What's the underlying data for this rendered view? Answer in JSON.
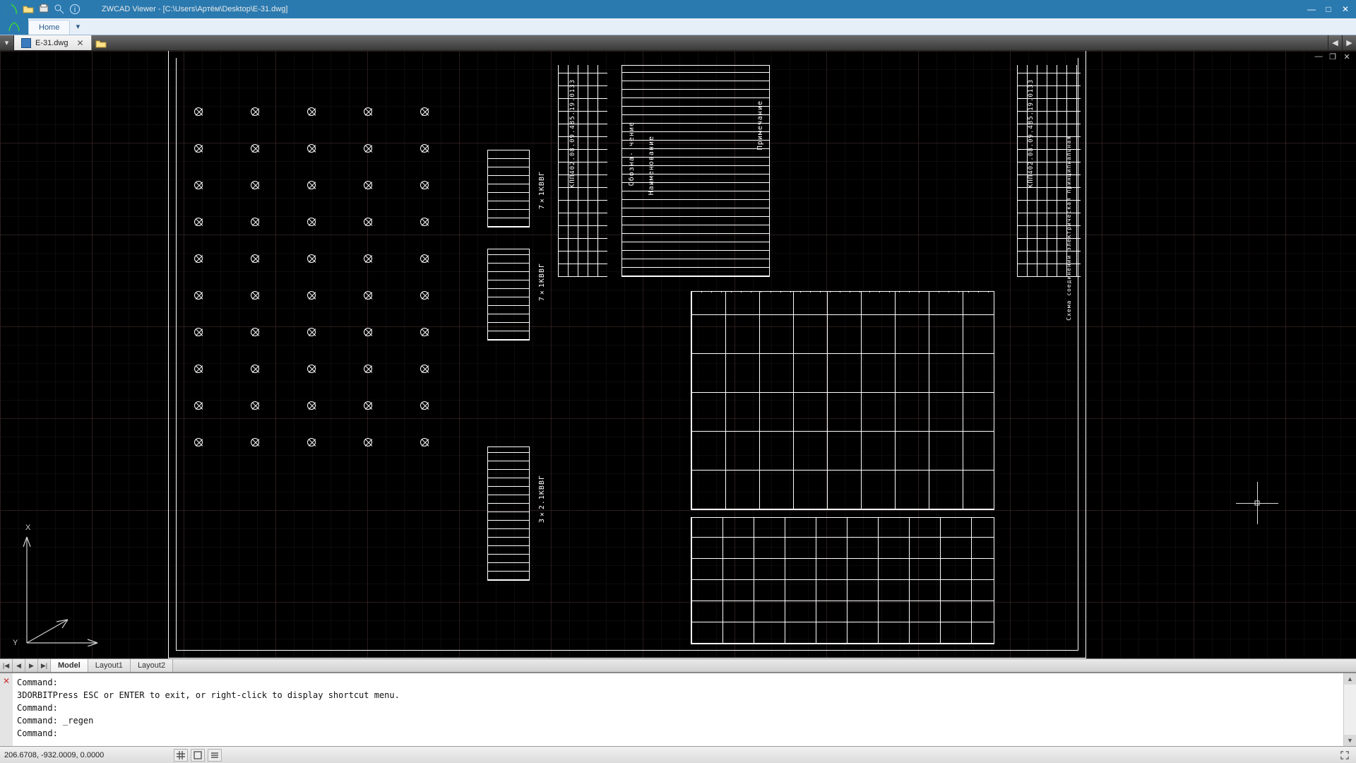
{
  "window": {
    "title": "ZWCAD Viewer - [C:\\Users\\Артём\\Desktop\\E-31.dwg]"
  },
  "ribbon": {
    "home": "Home"
  },
  "file_tab": {
    "name": "E-31.dwg"
  },
  "mdi": {
    "min": "—",
    "max": "❐",
    "close": "✕"
  },
  "layouts": {
    "nav": {
      "first": "|◀",
      "prev": "◀",
      "next": "▶",
      "last": "▶|"
    },
    "tabs": [
      "Model",
      "Layout1",
      "Layout2"
    ]
  },
  "drawing": {
    "doc_no_1": "КПП402.08.09.485.19.0133",
    "doc_no_2": "КПП402.08.09.485.19.0133",
    "cable1": "7×1КВВГ",
    "cable2": "7×1КВВГ",
    "cable3": "3×2.1КВВГ",
    "parts_header": "Наименование",
    "notes_header": "Примечание",
    "pos_header": "Обозна-\nчение",
    "project_header": "Схема соединений\nэлектрическая\nпринципиальная",
    "ucs_x": "X",
    "ucs_y": "Y"
  },
  "command": {
    "lines": "Command:\n3DORBITPress ESC or ENTER to exit, or right-click to display shortcut menu.\nCommand:\nCommand: _regen\nCommand:"
  },
  "status": {
    "coords": "206.6708, -932.0009, 0.0000"
  }
}
